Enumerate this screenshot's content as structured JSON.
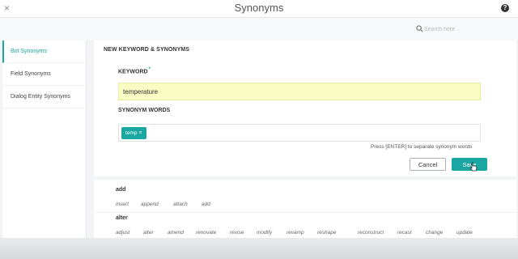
{
  "window": {
    "title": "Synonyms",
    "close_glyph": "×",
    "help_glyph": "?"
  },
  "search": {
    "placeholder": "Search here",
    "value": ""
  },
  "sidebar": {
    "items": [
      {
        "label": "Bot Synonyms",
        "active": true
      },
      {
        "label": "Field Synonyms",
        "active": false
      },
      {
        "label": "Dialog Entity Synonyms",
        "active": false
      }
    ]
  },
  "form": {
    "heading": "NEW KEYWORD & SYNONYMS",
    "keyword_label": "KEYWORD",
    "required_mark": "*",
    "keyword_value": "temperature",
    "synonyms_label": "SYNONYM WORDS",
    "chips": [
      {
        "text": "temp",
        "remove": "×"
      }
    ],
    "hint": "Press [ENTER] to separate synonym words",
    "cancel_label": "Cancel",
    "save_label": "Save"
  },
  "synonym_list": [
    {
      "word": "add",
      "synonyms": [
        "insert",
        "append",
        "attach",
        "add"
      ]
    },
    {
      "word": "alter",
      "synonyms": [
        "adjust",
        "alter",
        "amend",
        "renovate",
        "revise",
        "modify",
        "revamp",
        "reshape",
        "reconstruct",
        "recast",
        "change",
        "update"
      ]
    }
  ],
  "colors": {
    "accent": "#1ba7a1",
    "keyword_field_bg": "#fafdc3"
  }
}
